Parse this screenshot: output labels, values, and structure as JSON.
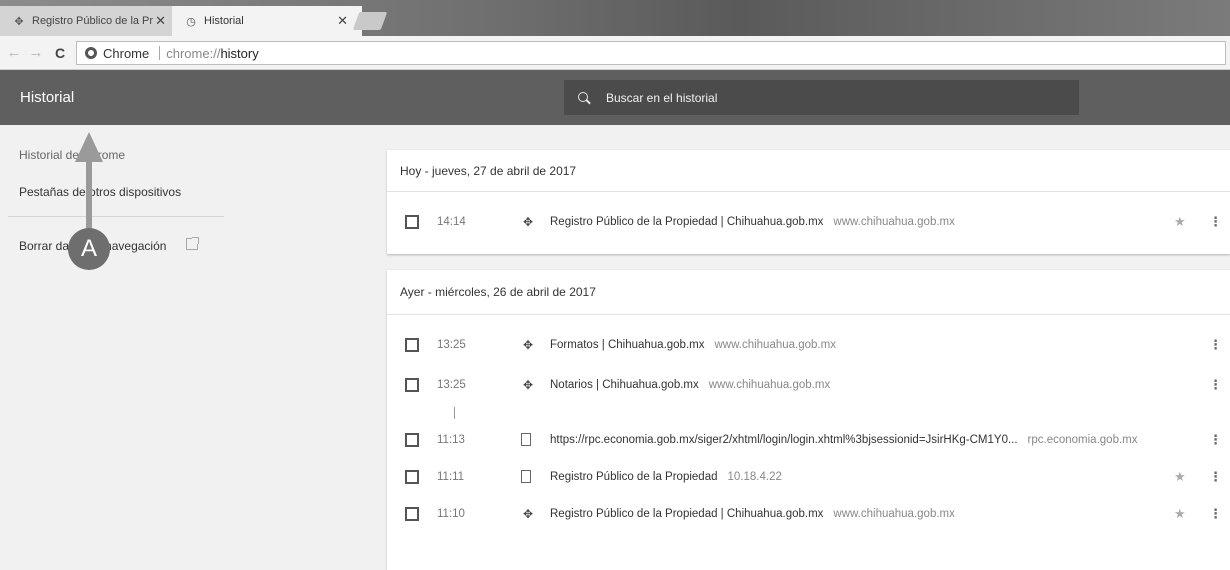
{
  "tabs": [
    {
      "label": "Registro Público de la Pr",
      "icon": "puzzle-icon",
      "active": false
    },
    {
      "label": "Historial",
      "icon": "history-icon",
      "active": true
    }
  ],
  "omnibox": {
    "chip_label": "Chrome",
    "url_scheme": "chrome://",
    "url_host": "history"
  },
  "header": {
    "title": "Historial",
    "search_placeholder": "Buscar en el historial"
  },
  "sidebar": {
    "items": [
      {
        "label": "Historial de Chrome"
      },
      {
        "label": "Pestañas de otros dispositivos"
      },
      {
        "label": "Borrar datos de navegación"
      }
    ]
  },
  "annotation": {
    "label": "A"
  },
  "groups": [
    {
      "heading": "Hoy - jueves, 27 de abril de 2017",
      "entries": [
        {
          "time": "14:14",
          "title": "Registro Público de la Propiedad | Chihuahua.gob.mx",
          "domain": "www.chihuahua.gob.mx",
          "icon": "puzzle-icon",
          "starred": true
        }
      ]
    },
    {
      "heading": "Ayer - miércoles, 26 de abril de 2017",
      "entries": [
        {
          "time": "13:25",
          "title": "Formatos | Chihuahua.gob.mx",
          "domain": "www.chihuahua.gob.mx",
          "icon": "puzzle-icon",
          "starred": false
        },
        {
          "time": "13:25",
          "title": "Notarios | Chihuahua.gob.mx",
          "domain": "www.chihuahua.gob.mx",
          "icon": "puzzle-icon",
          "starred": false
        },
        {
          "time": "11:13",
          "title": "https://rpc.economia.gob.mx/siger2/xhtml/login/login.xhtml%3bjsessionid=JsirHKg-CM1Y0...",
          "domain": "rpc.economia.gob.mx",
          "icon": "document-icon",
          "starred": false
        },
        {
          "time": "11:11",
          "title": "Registro Público de la Propiedad",
          "domain": "10.18.4.22",
          "icon": "document-icon",
          "starred": true
        },
        {
          "time": "11:10",
          "title": "Registro Público de la Propiedad | Chihuahua.gob.mx",
          "domain": "www.chihuahua.gob.mx",
          "icon": "puzzle-icon",
          "starred": true
        }
      ]
    }
  ]
}
